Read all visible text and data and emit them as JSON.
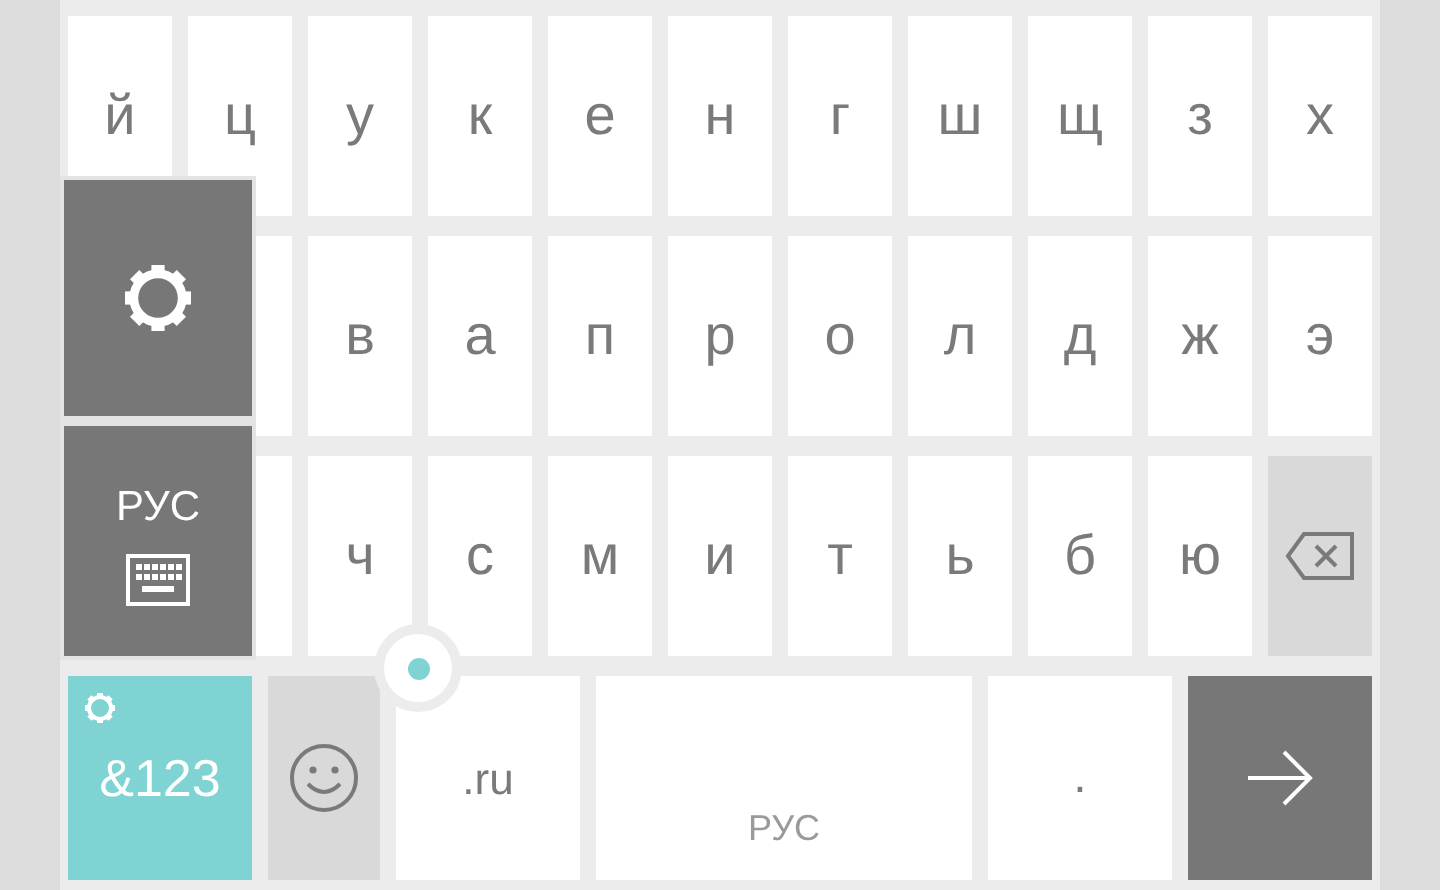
{
  "keyboard": {
    "rows": [
      {
        "keys": [
          {
            "kind": "letter",
            "label": "й"
          },
          {
            "kind": "letter",
            "label": "ц"
          },
          {
            "kind": "letter",
            "label": "у"
          },
          {
            "kind": "letter",
            "label": "к"
          },
          {
            "kind": "letter",
            "label": "е"
          },
          {
            "kind": "letter",
            "label": "н"
          },
          {
            "kind": "letter",
            "label": "г"
          },
          {
            "kind": "letter",
            "label": "ш"
          },
          {
            "kind": "letter",
            "label": "щ"
          },
          {
            "kind": "letter",
            "label": "з"
          },
          {
            "kind": "letter",
            "label": "х"
          }
        ]
      },
      {
        "keys": [
          {
            "kind": "covered"
          },
          {
            "kind": "letter",
            "label": "в"
          },
          {
            "kind": "letter",
            "label": "а"
          },
          {
            "kind": "letter",
            "label": "п"
          },
          {
            "kind": "letter",
            "label": "р"
          },
          {
            "kind": "letter",
            "label": "о"
          },
          {
            "kind": "letter",
            "label": "л"
          },
          {
            "kind": "letter",
            "label": "д"
          },
          {
            "kind": "letter",
            "label": "ж"
          },
          {
            "kind": "letter",
            "label": "э"
          }
        ]
      },
      {
        "keys": [
          {
            "kind": "covered"
          },
          {
            "kind": "letter",
            "label": "ч"
          },
          {
            "kind": "letter",
            "label": "с"
          },
          {
            "kind": "letter",
            "label": "м"
          },
          {
            "kind": "letter",
            "label": "и"
          },
          {
            "kind": "letter",
            "label": "т"
          },
          {
            "kind": "letter",
            "label": "ь"
          },
          {
            "kind": "letter",
            "label": "б"
          },
          {
            "kind": "letter",
            "label": "ю"
          },
          {
            "kind": "backspace"
          }
        ]
      }
    ],
    "bottom_row": [
      {
        "kind": "symbols",
        "label": "&123"
      },
      {
        "kind": "emoji"
      },
      {
        "kind": "domain",
        "label": ".ru"
      },
      {
        "kind": "space",
        "label": "РУС"
      },
      {
        "kind": "period",
        "label": "."
      },
      {
        "kind": "enter"
      }
    ]
  },
  "popup": {
    "items": [
      {
        "kind": "settings"
      },
      {
        "kind": "language",
        "label": "РУС"
      }
    ]
  }
}
